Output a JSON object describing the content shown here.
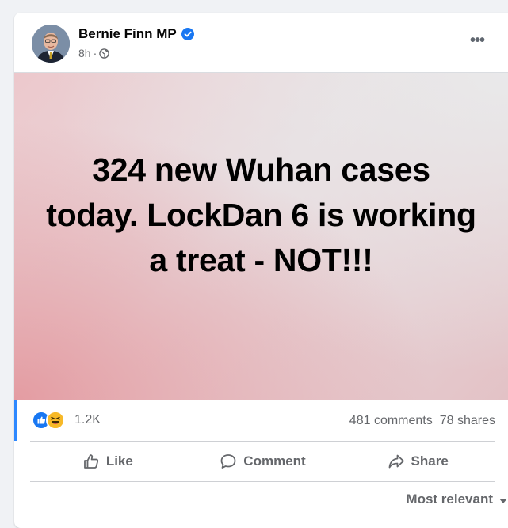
{
  "post": {
    "author": "Bernie Finn MP",
    "time": "8h",
    "time_separator": "·",
    "image_text": "324 new Wuhan cases today. LockDan 6 is working a treat - NOT!!!"
  },
  "stats": {
    "reaction_count": "1.2K",
    "comments": "481 comments",
    "shares": "78 shares"
  },
  "actions": {
    "like": "Like",
    "comment": "Comment",
    "share": "Share"
  },
  "comments_sort": {
    "label": "Most relevant"
  },
  "icons": {
    "verified": "verified-badge-icon",
    "audience": "globe-icon",
    "more": "more-options-icon",
    "like_reaction": "like-reaction-icon",
    "haha_reaction": "haha-reaction-icon",
    "like": "thumbs-up-icon",
    "comment": "speech-bubble-icon",
    "share": "share-arrow-icon",
    "sort": "caret-down-icon"
  },
  "colors": {
    "accent": "#1877f2",
    "text_secondary": "#65676b",
    "image_bg_pink": "#e49ca2"
  }
}
